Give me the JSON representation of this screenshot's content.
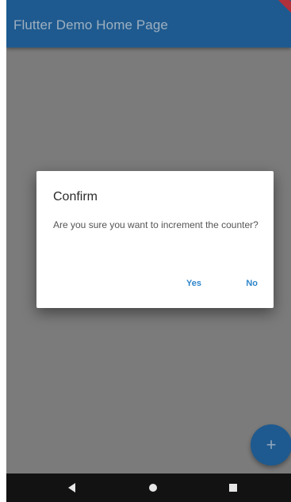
{
  "app_bar": {
    "title": "Flutter Demo Home Page"
  },
  "dialog": {
    "title": "Confirm",
    "message": "Are you sure you want to increment the counter?",
    "actions": [
      {
        "label": "Yes"
      },
      {
        "label": "No"
      }
    ]
  },
  "fab": {
    "icon": "add-icon",
    "glyph": "+"
  },
  "nav_bar": {
    "icons": [
      "back-icon",
      "home-icon",
      "recents-icon"
    ]
  },
  "colors": {
    "app_bar": "#1e5a8f",
    "scrim_background": "#7b7b7b",
    "dialog_button": "#2f86c9",
    "nav_bar": "#121212"
  }
}
